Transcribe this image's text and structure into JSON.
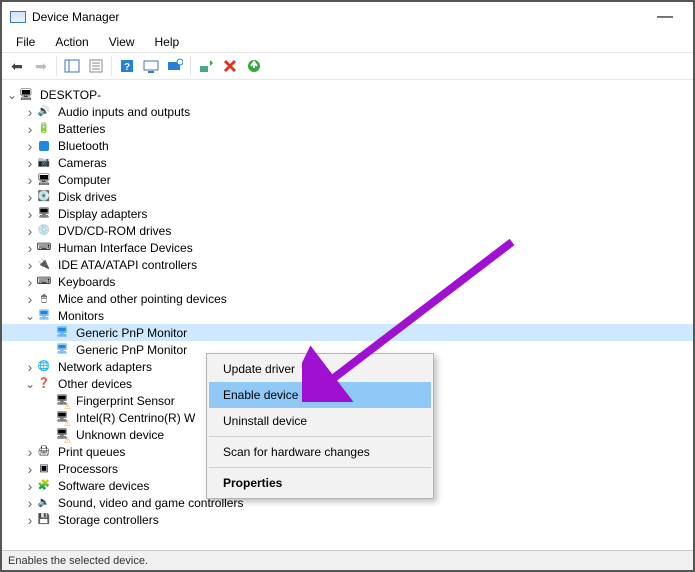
{
  "window": {
    "title": "Device Manager"
  },
  "menu": {
    "file": "File",
    "action": "Action",
    "view": "View",
    "help": "Help"
  },
  "tree": {
    "root": "DESKTOP-",
    "n1": "Audio inputs and outputs",
    "n2": "Batteries",
    "n3": "Bluetooth",
    "n4": "Cameras",
    "n5": "Computer",
    "n6": "Disk drives",
    "n7": "Display adapters",
    "n8": "DVD/CD-ROM drives",
    "n9": "Human Interface Devices",
    "n10": "IDE ATA/ATAPI controllers",
    "n11": "Keyboards",
    "n12": "Mice and other pointing devices",
    "n13": "Monitors",
    "n13a": "Generic PnP Monitor",
    "n13b": "Generic PnP Monitor",
    "n14": "Network adapters",
    "n15": "Other devices",
    "n15a": "Fingerprint Sensor",
    "n15b": "Intel(R) Centrino(R) W",
    "n15c": "Unknown device",
    "n16": "Print queues",
    "n17": "Processors",
    "n18": "Software devices",
    "n19": "Sound, video and game controllers",
    "n20": "Storage controllers"
  },
  "context_menu": {
    "update": "Update driver",
    "enable": "Enable device",
    "uninstall": "Uninstall device",
    "scan": "Scan for hardware changes",
    "properties": "Properties"
  },
  "status": "Enables the selected device."
}
